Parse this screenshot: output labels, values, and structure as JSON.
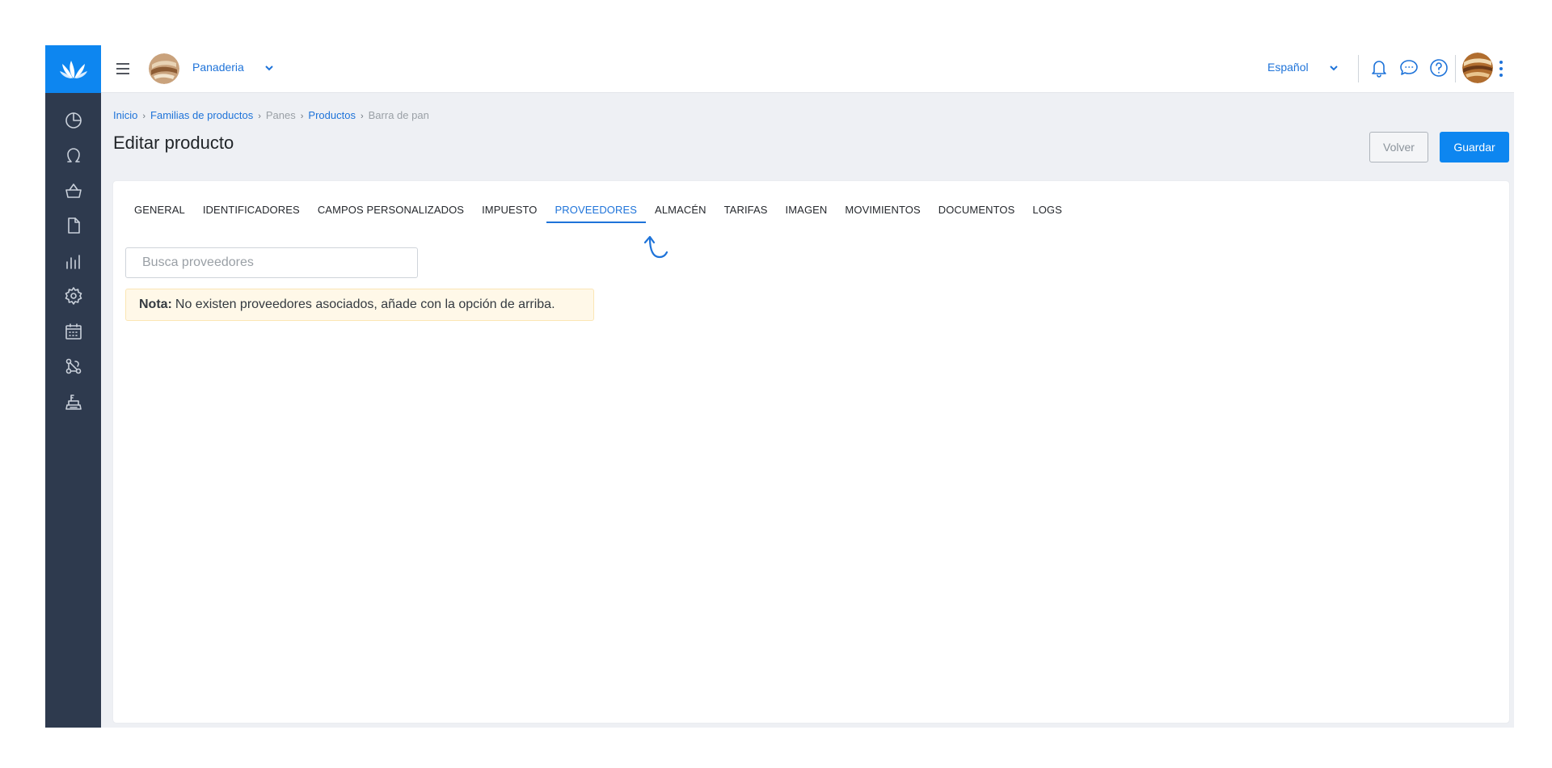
{
  "topbar": {
    "company_name": "Panaderia",
    "language": "Español"
  },
  "breadcrumb": [
    {
      "label": "Inicio",
      "link": true
    },
    {
      "label": "Familias de productos",
      "link": true
    },
    {
      "label": "Panes",
      "link": false
    },
    {
      "label": "Productos",
      "link": true
    },
    {
      "label": "Barra de pan",
      "link": false
    }
  ],
  "breadcrumb_separator": "›",
  "page": {
    "title": "Editar producto",
    "back_label": "Volver",
    "save_label": "Guardar"
  },
  "tabs": [
    {
      "label": "GENERAL",
      "active": false
    },
    {
      "label": "IDENTIFICADORES",
      "active": false
    },
    {
      "label": "CAMPOS PERSONALIZADOS",
      "active": false
    },
    {
      "label": "IMPUESTO",
      "active": false
    },
    {
      "label": "PROVEEDORES",
      "active": true
    },
    {
      "label": "ALMACÉN",
      "active": false
    },
    {
      "label": "TARIFAS",
      "active": false
    },
    {
      "label": "IMAGEN",
      "active": false
    },
    {
      "label": "MOVIMIENTOS",
      "active": false
    },
    {
      "label": "DOCUMENTOS",
      "active": false
    },
    {
      "label": "LOGS",
      "active": false
    }
  ],
  "search": {
    "placeholder": "Busca proveedores",
    "value": ""
  },
  "note": {
    "label": "Nota:",
    "text": "No existen proveedores asociados, añade con la opción de arriba."
  },
  "sidebar_icons": [
    "dashboard-icon",
    "contacts-icon",
    "sales-basket-icon",
    "documents-icon",
    "reports-icon",
    "settings-icon",
    "calendar-icon",
    "integrations-icon",
    "pos-register-icon"
  ],
  "colors": {
    "accent": "#0d86f0",
    "link": "#1e73d9",
    "sidebar": "#2e3a4e",
    "note_bg": "#fff8e8"
  }
}
